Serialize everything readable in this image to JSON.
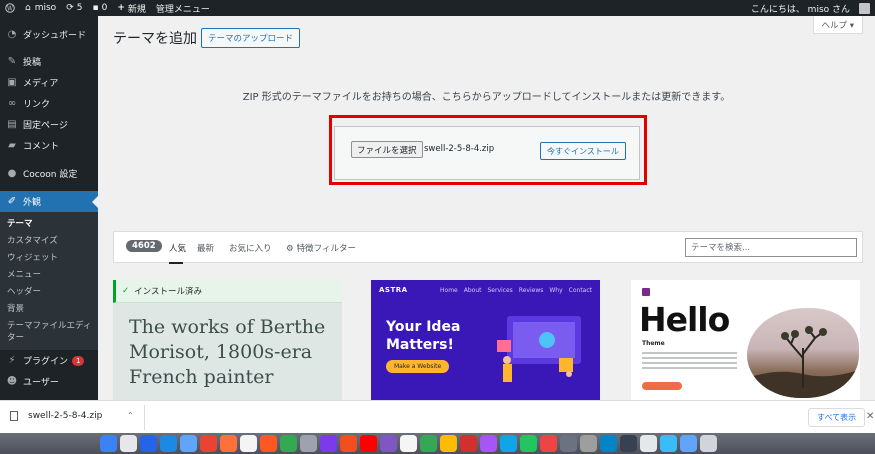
{
  "adminbar": {
    "site_name": "miso",
    "updates_count": "5",
    "comments_count": "0",
    "new_label": "新規",
    "admin_menu_label": "管理メニュー",
    "greeting": "こんにちは、 miso さん"
  },
  "sidebar": {
    "items": [
      {
        "label": "ダッシュボード",
        "icon": "gauge-icon"
      },
      {
        "label": "投稿",
        "icon": "pin-icon"
      },
      {
        "label": "メディア",
        "icon": "media-icon"
      },
      {
        "label": "リンク",
        "icon": "link-icon"
      },
      {
        "label": "固定ページ",
        "icon": "page-icon"
      },
      {
        "label": "コメント",
        "icon": "comment-icon"
      },
      {
        "label": "Cocoon 設定",
        "icon": "cocoon-icon"
      },
      {
        "label": "外観",
        "icon": "brush-icon"
      }
    ],
    "submenu": [
      "テーマ",
      "カスタマイズ",
      "ウィジェット",
      "メニュー",
      "ヘッダー",
      "背景",
      "テーマファイルエディター"
    ],
    "after": [
      {
        "label": "プラグイン",
        "icon": "plugin-icon",
        "badge": "1"
      },
      {
        "label": "ユーザー",
        "icon": "user-icon"
      }
    ]
  },
  "main": {
    "help_label": "ヘルプ ▾",
    "page_title": "テーマを追加",
    "upload_button": "テーマのアップロード",
    "upload_description": "ZIP 形式のテーマファイルをお持ちの場合、こちらからアップロードしてインストールまたは更新できます。",
    "choose_file_button": "ファイルを選択",
    "file_name": "swell-2-5-8-4.zip",
    "install_now_button": "今すぐインストール",
    "filter": {
      "count": "4602",
      "tabs": [
        "人気",
        "最新",
        "お気に入り"
      ],
      "feature_filter": "特徴フィルター",
      "search_placeholder": "テーマを検索..."
    },
    "cards": {
      "card1": {
        "installed_label": "インストール済み",
        "preview_text": "The works of Berthe Morisot, 1800s-era French painter"
      },
      "card2": {
        "logo": "ASTRA",
        "nav": [
          "Home",
          "About",
          "Services",
          "Reviews",
          "Why",
          "Contact"
        ],
        "headline_line1": "Your Idea",
        "headline_line2": "Matters!",
        "cta": "Make a Website"
      },
      "card3": {
        "headline": "Hello",
        "subtitle": "Theme"
      }
    }
  },
  "download_bar": {
    "file_name": "swell-2-5-8-4.zip",
    "show_all": "すべて表示"
  },
  "colors": {
    "admin_dark": "#1d2327",
    "wp_blue": "#2271b1",
    "highlight_red": "#e00000",
    "installed_green": "#00a32a"
  }
}
